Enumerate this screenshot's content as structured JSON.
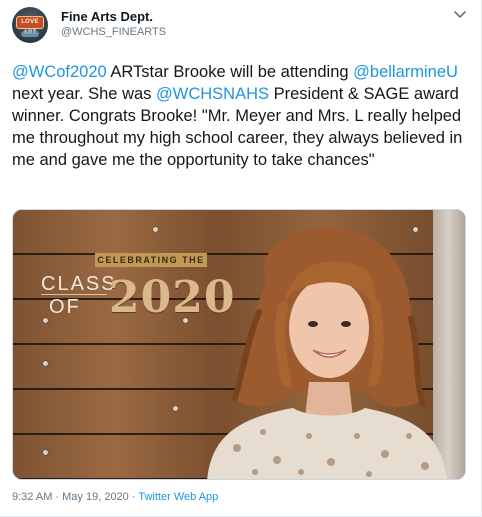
{
  "author": {
    "display_name": "Fine Arts Dept.",
    "handle": "@WCHS_FINEARTS",
    "avatar_sign_text": "LOVE ART"
  },
  "tweet": {
    "segments": [
      {
        "text": "@WCof2020",
        "mention": true
      },
      {
        "text": " ARTstar Brooke will be attending ",
        "mention": false
      },
      {
        "text": "@bellarmineU",
        "mention": true
      },
      {
        "text": " next year. She was ",
        "mention": false
      },
      {
        "text": "@WCHSNAHS",
        "mention": true
      },
      {
        "text": " President & SAGE award winner. Congrats Brooke! \"Mr. Meyer and Mrs. L really helped me throughout my high school career, they always believed in me and gave me the opportunity to take chances\"",
        "mention": false
      }
    ]
  },
  "media": {
    "banner_text": "CELEBRATING THE",
    "class_word": "CLASS",
    "of_word": "OF",
    "year": "2020"
  },
  "footer": {
    "time": "9:32 AM",
    "separator_1": " · ",
    "date": "May 19, 2020",
    "separator_2": " · ",
    "app": "Twitter Web App"
  },
  "colors": {
    "link": "#1b95e0",
    "secondary_text": "#657786",
    "primary_text": "#14171a"
  },
  "icons": {
    "menu": "chevron-down-icon"
  }
}
